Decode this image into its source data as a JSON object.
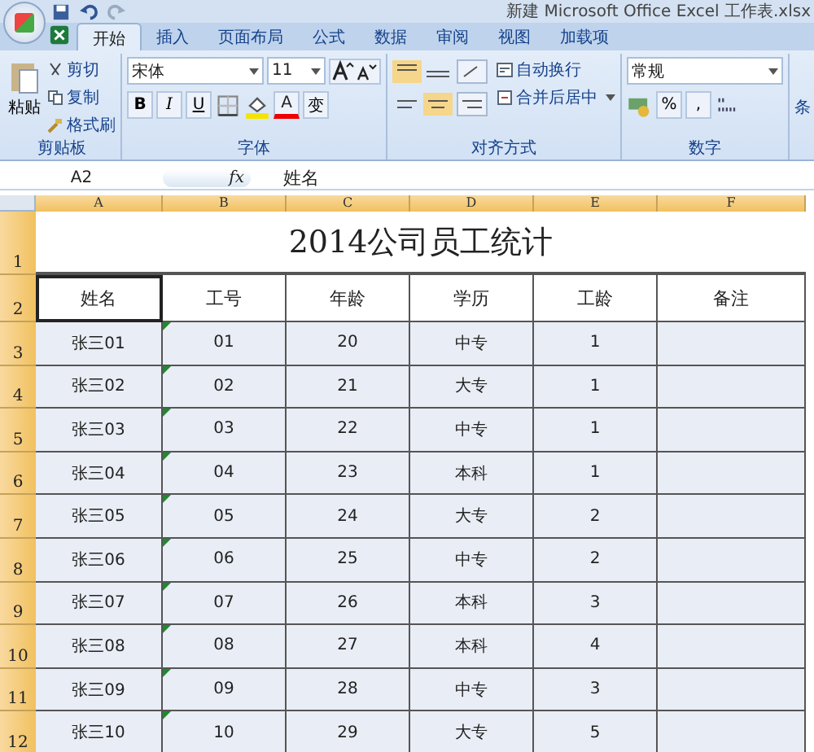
{
  "window": {
    "title": "新建 Microsoft Office Excel 工作表.xlsx"
  },
  "tabs": [
    {
      "label": "开始",
      "selected": true
    },
    {
      "label": "插入",
      "selected": false
    },
    {
      "label": "页面布局",
      "selected": false
    },
    {
      "label": "公式",
      "selected": false
    },
    {
      "label": "数据",
      "selected": false
    },
    {
      "label": "审阅",
      "selected": false
    },
    {
      "label": "视图",
      "selected": false
    },
    {
      "label": "加载项",
      "selected": false
    }
  ],
  "clipboard": {
    "label": "剪贴板",
    "paste": "粘贴",
    "cut": "剪切",
    "copy": "复制",
    "format_painter": "格式刷"
  },
  "font": {
    "label": "字体",
    "family": "宋体",
    "size": "11",
    "bold": "B",
    "italic": "I",
    "underline": "U",
    "color_letter": "A",
    "phonetic": "变"
  },
  "alignment": {
    "label": "对齐方式",
    "wrap": "自动换行",
    "merge": "合并后居中"
  },
  "number": {
    "label": "数字",
    "format": "常规",
    "percent": "%",
    "comma": ","
  },
  "styles": {
    "label": "条"
  },
  "formula_bar": {
    "name_box": "A2",
    "fx": "fx",
    "value": "姓名"
  },
  "sheet": {
    "columns": [
      "A",
      "B",
      "C",
      "D",
      "E",
      "F"
    ],
    "title": "2014公司员工统计",
    "headers": [
      "姓名",
      "工号",
      "年龄",
      "学历",
      "工龄",
      "备注"
    ],
    "rows": [
      [
        "张三01",
        "01",
        "20",
        "中专",
        "1",
        ""
      ],
      [
        "张三02",
        "02",
        "21",
        "大专",
        "1",
        ""
      ],
      [
        "张三03",
        "03",
        "22",
        "中专",
        "1",
        ""
      ],
      [
        "张三04",
        "04",
        "23",
        "本科",
        "1",
        ""
      ],
      [
        "张三05",
        "05",
        "24",
        "大专",
        "2",
        ""
      ],
      [
        "张三06",
        "06",
        "25",
        "中专",
        "2",
        ""
      ],
      [
        "张三07",
        "07",
        "26",
        "本科",
        "3",
        ""
      ],
      [
        "张三08",
        "08",
        "27",
        "本科",
        "4",
        ""
      ],
      [
        "张三09",
        "09",
        "28",
        "中专",
        "3",
        ""
      ],
      [
        "张三10",
        "10",
        "29",
        "大专",
        "5",
        ""
      ]
    ],
    "row_numbers": [
      "1",
      "2",
      "3",
      "4",
      "5",
      "6",
      "7",
      "8",
      "9",
      "10",
      "11",
      "12"
    ]
  }
}
